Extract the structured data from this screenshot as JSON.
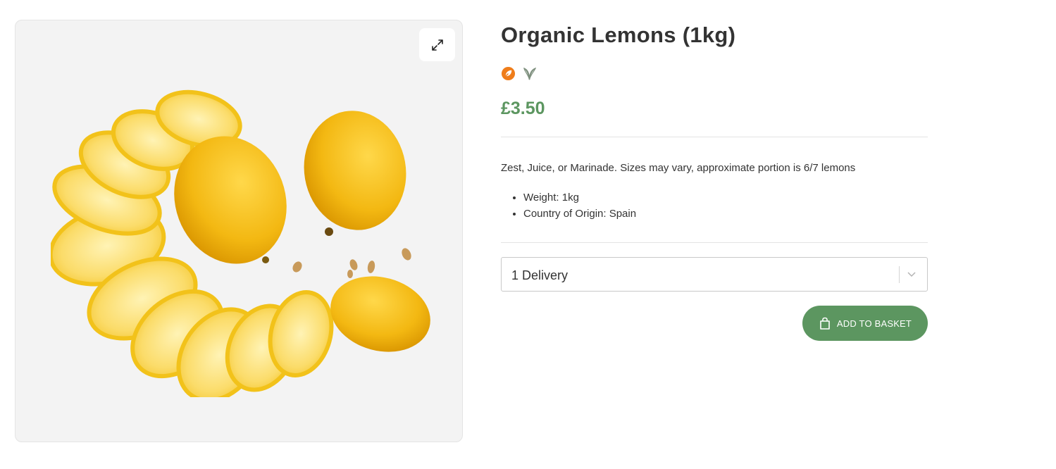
{
  "product": {
    "title": "Organic Lemons (1kg)",
    "price": "£3.50",
    "description": "Zest, Juice, or Marinade. Sizes may vary, approximate portion is 6/7 lemons",
    "specs": [
      "Weight: 1kg",
      "Country of Origin: Spain"
    ],
    "badges": [
      {
        "icon": "organic-leaf-icon",
        "color": "#ef7d1a"
      },
      {
        "icon": "vegan-sprout-icon",
        "color": "#7d8f7d"
      }
    ]
  },
  "gallery": {
    "expand_icon": "expand-arrows-icon",
    "image_subject": "lemons-image"
  },
  "purchase": {
    "delivery_selected": "1 Delivery",
    "add_to_basket_label": "ADD TO BASKET",
    "basket_icon": "shopping-bag-icon"
  },
  "colors": {
    "accent": "#5c9660",
    "organic_badge": "#ef7d1a",
    "gallery_bg": "#f3f3f3"
  }
}
